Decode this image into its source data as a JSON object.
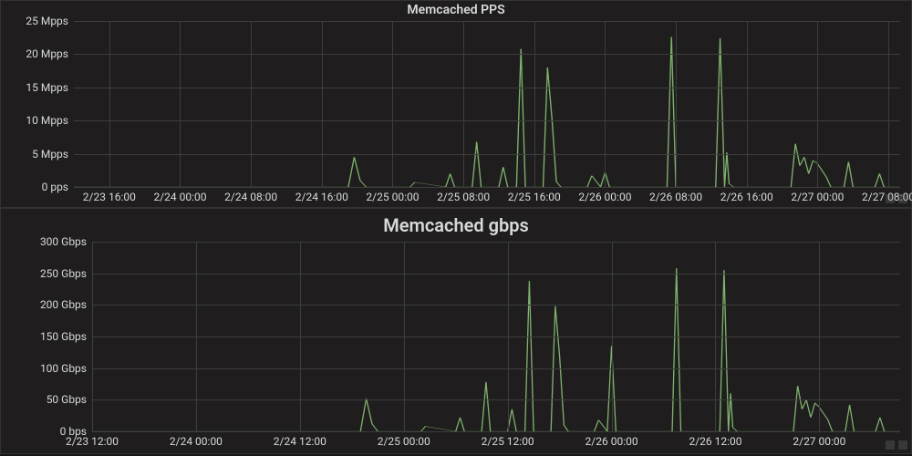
{
  "accent_color": "#7eb26d",
  "chart_data": [
    {
      "type": "line",
      "title": "Memcached PPS",
      "xlabel": "",
      "ylabel": "",
      "y_ticks": [
        "0 pps",
        "5 Mpps",
        "10 Mpps",
        "15 Mpps",
        "20 Mpps",
        "25 Mpps"
      ],
      "ylim": [
        0,
        25
      ],
      "x_ticks": [
        "2/23 16:00",
        "2/24 00:00",
        "2/24 08:00",
        "2/24 16:00",
        "2/25 00:00",
        "2/25 08:00",
        "2/25 16:00",
        "2/26 00:00",
        "2/26 08:00",
        "2/26 16:00",
        "2/27 00:00",
        "2/27 08:00"
      ],
      "series": [
        {
          "name": "pps",
          "x": [
            "2/23 12:00",
            "2/24 19:00",
            "2/24 19:40",
            "2/24 20:20",
            "2/24 21:00",
            "2/25 02:00",
            "2/25 02:30",
            "2/25 06:00",
            "2/25 06:30",
            "2/25 07:00",
            "2/25 09:00",
            "2/25 09:30",
            "2/25 10:00",
            "2/25 12:00",
            "2/25 12:30",
            "2/25 13:00",
            "2/25 14:00",
            "2/25 14:30",
            "2/25 15:00",
            "2/25 17:00",
            "2/25 17:30",
            "2/25 18:00",
            "2/25 18:30",
            "2/25 19:00",
            "2/25 22:00",
            "2/25 22:30",
            "2/25 23:30",
            "2/26 00:00",
            "2/26 00:30",
            "2/26 07:00",
            "2/26 07:30",
            "2/26 08:00",
            "2/26 12:30",
            "2/26 13:00",
            "2/26 13:30",
            "2/26 13:45",
            "2/26 14:00",
            "2/26 14:30",
            "2/26 21:00",
            "2/26 21:30",
            "2/26 22:00",
            "2/26 22:30",
            "2/26 23:00",
            "2/26 23:30",
            "2/27 00:00",
            "2/27 00:30",
            "2/27 01:00",
            "2/27 01:30",
            "2/27 03:00",
            "2/27 03:30",
            "2/27 04:00",
            "2/27 06:30",
            "2/27 07:00",
            "2/27 07:30",
            "2/27 09:20"
          ],
          "values": [
            0,
            0,
            4.5,
            1,
            0,
            0,
            0.7,
            0,
            2,
            0,
            0,
            6.8,
            0,
            0,
            3,
            0,
            0,
            20.8,
            0,
            0,
            18,
            10.3,
            0.8,
            0,
            0,
            1.7,
            0,
            2.2,
            0,
            0,
            22.6,
            0,
            0,
            22.4,
            0,
            5.2,
            0.5,
            0,
            0,
            6.5,
            3.2,
            4.5,
            2,
            4,
            3.5,
            2.5,
            1.5,
            0,
            0,
            3.8,
            0,
            0,
            2,
            0,
            0
          ]
        }
      ]
    },
    {
      "type": "line",
      "title": "Memcached gbps",
      "xlabel": "",
      "ylabel": "",
      "y_ticks": [
        "0 bps",
        "50 Gbps",
        "100 Gbps",
        "150 Gbps",
        "200 Gbps",
        "250 Gbps",
        "300 Gbps"
      ],
      "ylim": [
        0,
        300
      ],
      "x_ticks": [
        "2/23 12:00",
        "2/24 00:00",
        "2/24 12:00",
        "2/25 00:00",
        "2/25 12:00",
        "2/26 00:00",
        "2/26 12:00",
        "2/27 00:00"
      ],
      "series": [
        {
          "name": "gbps",
          "x": [
            "2/23 12:00",
            "2/24 19:00",
            "2/24 19:40",
            "2/24 20:20",
            "2/24 21:00",
            "2/25 02:00",
            "2/25 02:30",
            "2/25 06:00",
            "2/25 06:30",
            "2/25 07:00",
            "2/25 09:00",
            "2/25 09:30",
            "2/25 10:00",
            "2/25 12:00",
            "2/25 12:30",
            "2/25 13:00",
            "2/25 14:00",
            "2/25 14:30",
            "2/25 15:00",
            "2/25 17:00",
            "2/25 17:30",
            "2/25 18:00",
            "2/25 18:30",
            "2/25 19:00",
            "2/25 22:00",
            "2/25 22:30",
            "2/25 23:30",
            "2/26 00:00",
            "2/26 00:30",
            "2/26 07:00",
            "2/26 07:30",
            "2/26 08:00",
            "2/26 12:30",
            "2/26 13:00",
            "2/26 13:30",
            "2/26 13:45",
            "2/26 14:00",
            "2/26 14:30",
            "2/26 21:00",
            "2/26 21:30",
            "2/26 22:00",
            "2/26 22:30",
            "2/26 23:00",
            "2/26 23:30",
            "2/27 00:00",
            "2/27 00:30",
            "2/27 01:00",
            "2/27 01:30",
            "2/27 03:00",
            "2/27 03:30",
            "2/27 04:00",
            "2/27 06:30",
            "2/27 07:00",
            "2/27 07:30",
            "2/27 09:20"
          ],
          "values": [
            0,
            0,
            52,
            12,
            0,
            0,
            8,
            0,
            22,
            0,
            0,
            78,
            0,
            0,
            35,
            0,
            0,
            238,
            0,
            0,
            198,
            118,
            10,
            0,
            0,
            18,
            0,
            135,
            0,
            0,
            258,
            0,
            0,
            255,
            0,
            60,
            6,
            0,
            0,
            72,
            35,
            50,
            22,
            45,
            38,
            28,
            18,
            0,
            0,
            42,
            0,
            0,
            22,
            0,
            0
          ]
        }
      ]
    }
  ]
}
